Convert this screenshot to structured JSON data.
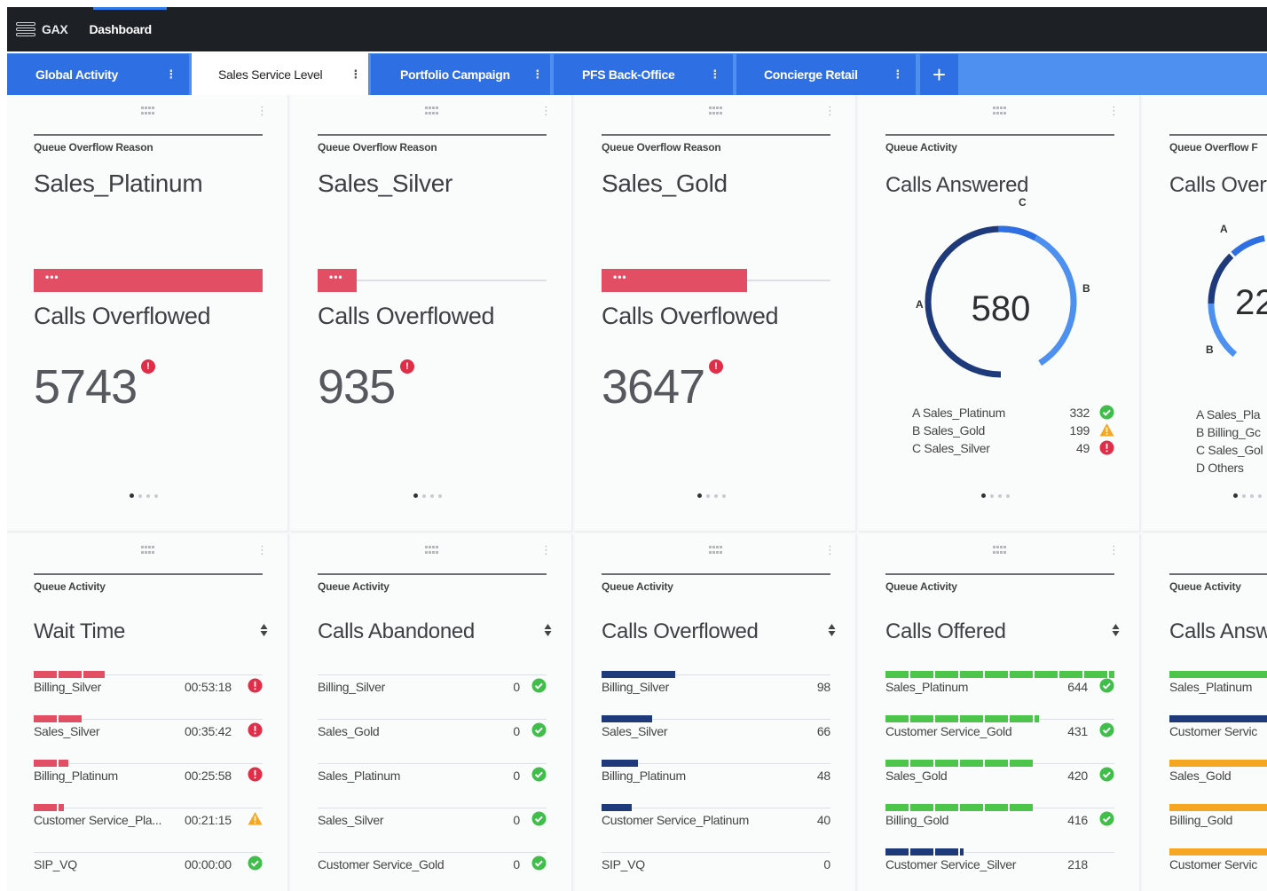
{
  "header": {
    "app_name": "GAX",
    "page": "Dashboard"
  },
  "tabs": [
    {
      "label": "Global Activity",
      "active": false
    },
    {
      "label": "Sales Service Level",
      "active": true
    },
    {
      "label": "Portfolio Campaign",
      "active": false
    },
    {
      "label": "PFS Back-Office",
      "active": false
    },
    {
      "label": "Concierge Retail",
      "active": false
    }
  ],
  "tab_menu_glyph": "⋮",
  "add_tab_glyph": "+",
  "cards_top": [
    {
      "category": "Queue Overflow Reason",
      "title": "Sales_Platinum",
      "metric": "Calls Overflowed",
      "value": "5743",
      "bar_fraction": 1.0,
      "badge": "!"
    },
    {
      "category": "Queue Overflow Reason",
      "title": "Sales_Silver",
      "metric": "Calls Overflowed",
      "value": "935",
      "bar_fraction": 0.17,
      "badge": "!"
    },
    {
      "category": "Queue Overflow Reason",
      "title": "Sales_Gold",
      "metric": "Calls Overflowed",
      "value": "3647",
      "bar_fraction": 0.635,
      "badge": "!"
    }
  ],
  "calls_answered": {
    "category": "Queue Activity",
    "title": "Calls Answered",
    "total": "580",
    "labels": [
      "A",
      "B",
      "C"
    ],
    "legend": [
      {
        "name": "A Sales_Platinum",
        "value": "332",
        "status": "ok"
      },
      {
        "name": "B Sales_Gold",
        "value": "199",
        "status": "warn"
      },
      {
        "name": "C Sales_Silver",
        "value": "49",
        "status": "error"
      }
    ]
  },
  "calls_overflowed_partial": {
    "category": "Queue Overflow F",
    "title": "Calls Overf",
    "total": "22",
    "labels": [
      "A",
      "B"
    ],
    "legend": [
      "A Sales_Pla",
      "B Billing_Gc",
      "C Sales_Gol",
      "D Others"
    ]
  },
  "wait_time": {
    "category": "Queue Activity",
    "title": "Wait Time",
    "rows": [
      {
        "name": "Billing_Silver",
        "value": "00:53:18",
        "fraction": 0.31,
        "status": "error"
      },
      {
        "name": "Sales_Silver",
        "value": "00:35:42",
        "fraction": 0.21,
        "status": "error"
      },
      {
        "name": "Billing_Platinum",
        "value": "00:25:58",
        "fraction": 0.15,
        "status": "error"
      },
      {
        "name": "Customer Service_Pla...",
        "value": "00:21:15",
        "fraction": 0.13,
        "status": "warn"
      },
      {
        "name": "SIP_VQ",
        "value": "00:00:00",
        "fraction": 0.0,
        "status": "ok"
      }
    ]
  },
  "calls_abandoned": {
    "category": "Queue Activity",
    "title": "Calls Abandoned",
    "rows": [
      {
        "name": "Billing_Silver",
        "value": "0",
        "fraction": 0,
        "status": "ok"
      },
      {
        "name": "Sales_Gold",
        "value": "0",
        "fraction": 0,
        "status": "ok"
      },
      {
        "name": "Sales_Platinum",
        "value": "0",
        "fraction": 0,
        "status": "ok"
      },
      {
        "name": "Sales_Silver",
        "value": "0",
        "fraction": 0,
        "status": "ok"
      },
      {
        "name": "Customer Service_Gold",
        "value": "0",
        "fraction": 0,
        "status": "ok"
      }
    ]
  },
  "calls_overflowed_list": {
    "category": "Queue Activity",
    "title": "Calls Overflowed",
    "rows": [
      {
        "name": "Billing_Silver",
        "value": "98",
        "fraction": 0.32
      },
      {
        "name": "Sales_Silver",
        "value": "66",
        "fraction": 0.22
      },
      {
        "name": "Billing_Platinum",
        "value": "48",
        "fraction": 0.16
      },
      {
        "name": "Customer Service_Platinum",
        "value": "40",
        "fraction": 0.13
      },
      {
        "name": "SIP_VQ",
        "value": "0",
        "fraction": 0
      }
    ]
  },
  "calls_offered": {
    "category": "Queue Activity",
    "title": "Calls Offered",
    "rows": [
      {
        "name": "Sales_Platinum",
        "value": "644",
        "fraction": 1.0,
        "status": "ok"
      },
      {
        "name": "Customer Service_Gold",
        "value": "431",
        "fraction": 0.67,
        "status": "ok"
      },
      {
        "name": "Sales_Gold",
        "value": "420",
        "fraction": 0.65,
        "status": "ok"
      },
      {
        "name": "Billing_Gold",
        "value": "416",
        "fraction": 0.645,
        "status": "ok"
      },
      {
        "name": "Customer Service_Silver",
        "value": "218",
        "fraction": 0.34,
        "status": "none"
      }
    ]
  },
  "calls_answered_partial_list": {
    "category": "Queue Activity",
    "title": "Calls Answ",
    "rows": [
      "Sales_Platinum",
      "Customer Servic",
      "Sales_Gold",
      "Billing_Gold",
      "Customer Servic"
    ]
  },
  "colors": {
    "overflow_red": "#e24e63",
    "ok_green": "#3fbf4a",
    "warn_orange": "#f5a623",
    "error_red": "#e02d48",
    "navy": "#1f3a7a",
    "light_blue": "#4e90ef",
    "bar_green": "#4cc54a",
    "bar_orange": "#f5a623"
  }
}
